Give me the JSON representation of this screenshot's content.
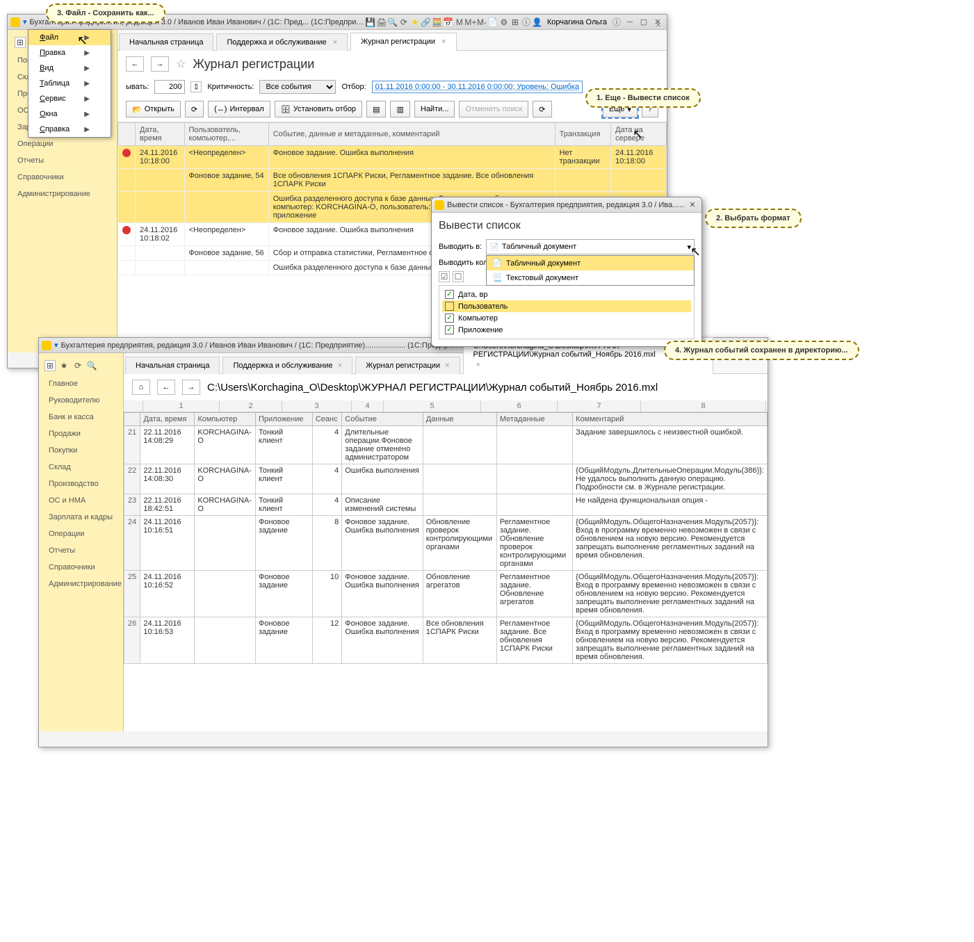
{
  "win1": {
    "title": "Бухгалтерия предприятия, редакция 3.0 / Иванов Иван Иванович / (1С: Пред...   (1С:Предприятие)",
    "user_right": "Корчагина Ольга",
    "tabs": [
      "Начальная страница",
      "Поддержка и обслуживание",
      "Журнал регистрации"
    ],
    "nav": [
      "Покупки",
      "Склад",
      "Производство",
      "ОС и НМА",
      "Зарплата и кадры",
      "Операции",
      "Отчеты",
      "Справочники",
      "Администрирование"
    ],
    "page_title": "Журнал регистрации",
    "filter": {
      "show_label": "ывать:",
      "show_value": "200",
      "crit_label": "Критичность:",
      "crit_value": "Все события",
      "otbor_label": "Отбор:",
      "otbor_value": "01.11.2016 0:00:00 - 30.11.2016 0:00:00; Уровень: Ошибка"
    },
    "buttons": {
      "open": "Открыть",
      "interval": "Интервал",
      "set_filter": "Установить отбор",
      "find": "Найти...",
      "cancel_find": "Отменить поиск",
      "more": "Еще",
      "help": "?"
    },
    "grid_headers": [
      "",
      "Дата, время",
      "Пользователь, компьютер,...",
      "Событие, данные и метаданные, комментарий",
      "Транзакция",
      "Дата на сервере"
    ],
    "rows": [
      {
        "hl": true,
        "err": true,
        "dt": "24.11.2016",
        "tm": "10:18:00",
        "user": "<Неопределен>",
        "event": "Фоновое задание. Ошибка выполнения",
        "trans": "Нет транзакции",
        "srv_dt": "24.11.2016",
        "srv_tm": "10:18:00"
      },
      {
        "hl": true,
        "user": "Фоновое задание, 54",
        "event": "Все обновления 1СПАРК Риски, Регламентное задание. Все обновления 1СПАРК Риски"
      },
      {
        "hl": true,
        "event": "Ошибка разделенного доступа к базе данных. База данных заблокирована: компьютер: KORCHAGINA-O, пользователь: 4, начат: 24.11.2016 в 10:17:14, приложение"
      },
      {
        "err": true,
        "dt": "24.11.2016",
        "tm": "10:18:02",
        "user": "<Неопределен>",
        "event": "Фоновое задание. Ошибка выполнения"
      },
      {
        "user": "Фоновое задание, 56",
        "event": "Сбор и отправка статистики, Регламентное отправка статистики"
      },
      {
        "event": "Ошибка разделенного доступа к базе данных. База данных заблокирована:"
      }
    ]
  },
  "menu": {
    "items": [
      {
        "label": "Файл",
        "sub": true,
        "active": true
      },
      {
        "label": "Правка",
        "sub": true
      },
      {
        "label": "Вид",
        "sub": true
      },
      {
        "label": "Таблица",
        "sub": true
      },
      {
        "label": "Сервис",
        "sub": true
      },
      {
        "label": "Окна",
        "sub": true
      },
      {
        "label": "Справка",
        "sub": true
      }
    ]
  },
  "dialog": {
    "title_bar": "Вывести список - Бухгалтерия предприятия, редакция 3.0 / Ива...  (1С:Предприятие)",
    "title": "Вывести список",
    "output_label": "Выводить в:",
    "output_value": "Табличный документ",
    "cols_label": "Выводить кол",
    "options": [
      "Табличный документ",
      "Текстовый документ"
    ],
    "checks": [
      {
        "label": "Дата, вр",
        "checked": true
      },
      {
        "label": "Пользователь",
        "checked": false,
        "hl": true
      },
      {
        "label": "Компьютер",
        "checked": true
      },
      {
        "label": "Приложение",
        "checked": true
      }
    ]
  },
  "callouts": {
    "c1": "1. Еще - Вывести список",
    "c2": "2. Выбрать формат",
    "c3": "3. Файл - Сохранить как...",
    "c4": "4. Журнал событий сохранен в директорию..."
  },
  "win2": {
    "title": "Бухгалтерия предприятия, редакция 3.0 / Иванов Иван Иванович / (1С: Предприятие)...................   (1С:Предприятие)",
    "tabs": [
      "Начальная страница",
      "Поддержка и обслуживание",
      "Журнал регистрации",
      "C:\\Users\\Korchagina_O\\Desktop\\ЖУРНАЛ РЕГИСТРАЦИИ\\Журнал событий_Ноябрь 2016.mxl"
    ],
    "nav": [
      "Главное",
      "Руководителю",
      "Банк и касса",
      "Продажи",
      "Покупки",
      "Склад",
      "Производство",
      "ОС и НМА",
      "Зарплата и кадры",
      "Операции",
      "Отчеты",
      "Справочники",
      "Администрирование"
    ],
    "path": "C:\\Users\\Korchagina_O\\Desktop\\ЖУРНАЛ РЕГИСТРАЦИИ\\Журнал событий_Ноябрь 2016.mxl",
    "ruler": [
      "1",
      "2",
      "3",
      "4",
      "5",
      "6",
      "7",
      "8"
    ],
    "headers": [
      "",
      "Дата, время",
      "Компьютер",
      "Приложение",
      "Сеанс",
      "Событие",
      "Данные",
      "Метаданные",
      "Комментарий"
    ],
    "rows": [
      {
        "n": "21",
        "dt": "22.11.2016 14:08:29",
        "comp": "KORCHAGINA-O",
        "app": "Тонкий клиент",
        "sess": "4",
        "event": "Длительные операции.Фоновое задание отменено администратором",
        "data": "",
        "meta": "",
        "comm": "Задание завершилось с неизвестной ошибкой."
      },
      {
        "n": "22",
        "dt": "22.11.2016 14:08:30",
        "comp": "KORCHAGINA-O",
        "app": "Тонкий клиент",
        "sess": "4",
        "event": "Ошибка выполнения",
        "data": "",
        "meta": "",
        "comm": "{ОбщийМодуль.ДлительныеОперации.Модуль(386)}: Не удалось выполнить данную операцию. Подробности см. в Журнале регистрации."
      },
      {
        "n": "23",
        "dt": "22.11.2016 18:42:51",
        "comp": "KORCHAGINA-O",
        "app": "Тонкий клиент",
        "sess": "4",
        "event": "Описание изменений системы",
        "data": "",
        "meta": "",
        "comm": "Не найдена функциональная опция -"
      },
      {
        "n": "24",
        "dt": "24.11.2016 10:16:51",
        "comp": "",
        "app": "Фоновое задание",
        "sess": "8",
        "event": "Фоновое задание. Ошибка выполнения",
        "data": "Обновление проверок контролирующими органами",
        "meta": "Регламентное задание. Обновление проверок контролирующими органами",
        "comm": "{ОбщийМодуль.ОбщегоНазначения.Модуль(2057)}: Вход в программу временно невозможен в связи с обновлением на новую версию. Рекомендуется запрещать выполнение регламентных заданий на время обновления."
      },
      {
        "n": "25",
        "dt": "24.11.2016 10:16:52",
        "comp": "",
        "app": "Фоновое задание",
        "sess": "10",
        "event": "Фоновое задание. Ошибка выполнения",
        "data": "Обновление агрегатов",
        "meta": "Регламентное задание. Обновление агрегатов",
        "comm": "{ОбщийМодуль.ОбщегоНазначения.Модуль(2057)}: Вход в программу временно невозможен в связи с обновлением на новую версию. Рекомендуется запрещать выполнение регламентных заданий на время обновления."
      },
      {
        "n": "26",
        "dt": "24.11.2016 10:16:53",
        "comp": "",
        "app": "Фоновое задание",
        "sess": "12",
        "event": "Фоновое задание. Ошибка выполнения",
        "data": "Все обновления 1СПАРК Риски",
        "meta": "Регламентное задание. Все обновления 1СПАРК Риски",
        "comm": "{ОбщийМодуль.ОбщегоНазначения.Модуль(2057)}: Вход в программу временно невозможен в связи с обновлением на новую версию. Рекомендуется запрещать выполнение регламентных заданий на время обновления."
      }
    ]
  },
  "toolbar_letters": {
    "m": "M",
    "mplus": "M+",
    "mminus": "M-"
  }
}
